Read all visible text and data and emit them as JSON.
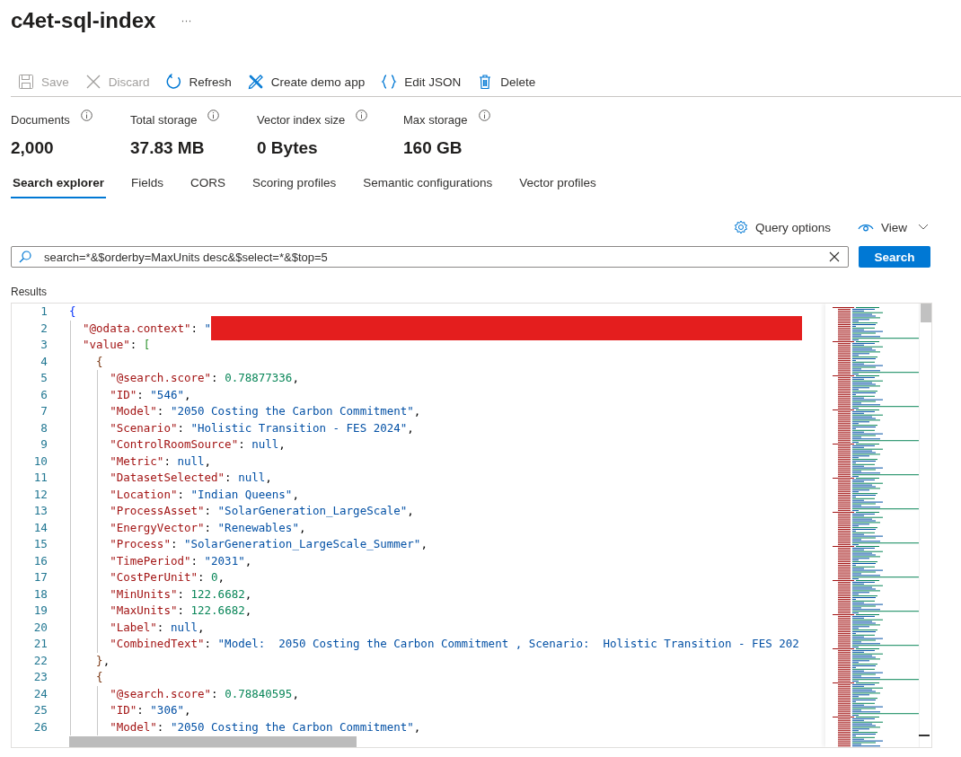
{
  "title": "c4et-sql-index",
  "more": "···",
  "toolbar": [
    {
      "label": "Save",
      "disabled": true
    },
    {
      "label": "Discard",
      "disabled": true
    },
    {
      "label": "Refresh",
      "disabled": false
    },
    {
      "label": "Create demo app",
      "disabled": false
    },
    {
      "label": "Edit JSON",
      "disabled": false
    },
    {
      "label": "Delete",
      "disabled": false
    }
  ],
  "stats": [
    {
      "label": "Documents",
      "value": "2,000"
    },
    {
      "label": "Total storage",
      "value": "37.83 MB"
    },
    {
      "label": "Vector index size",
      "value": "0 Bytes"
    },
    {
      "label": "Max storage",
      "value": "160 GB"
    }
  ],
  "tabs": [
    {
      "label": "Search explorer",
      "selected": true
    },
    {
      "label": "Fields",
      "selected": false
    },
    {
      "label": "CORS",
      "selected": false
    },
    {
      "label": "Scoring profiles",
      "selected": false
    },
    {
      "label": "Semantic configurations",
      "selected": false
    },
    {
      "label": "Vector profiles",
      "selected": false
    }
  ],
  "query_options": "Query options",
  "view": "View",
  "search": {
    "value": "search=*&$orderby=MaxUnits desc&$select=*&$top=5",
    "button": "Search"
  },
  "results": {
    "label": "Results",
    "lines": [
      {
        "number": "1",
        "tokens": [
          {
            "kind": "br1",
            "text": "{"
          }
        ]
      },
      {
        "number": "2",
        "tokens": [
          {
            "kind": "key",
            "text": "\"@odata.context\""
          },
          {
            "kind": "punct",
            "text": ": "
          },
          {
            "kind": "str",
            "text": "\""
          },
          {
            "kind": "redacted"
          }
        ]
      },
      {
        "number": "3",
        "tokens": [
          {
            "kind": "key",
            "text": "\"value\""
          },
          {
            "kind": "punct",
            "text": ": "
          },
          {
            "kind": "br2",
            "text": "["
          }
        ]
      },
      {
        "number": "4",
        "tokens": [
          {
            "kind": "br3",
            "text": "{"
          }
        ]
      },
      {
        "number": "5",
        "tokens": [
          {
            "kind": "key",
            "text": "\"@search.score\""
          },
          {
            "kind": "punct",
            "text": ": "
          },
          {
            "kind": "num",
            "text": "0.78877336"
          },
          {
            "kind": "punct",
            "text": ","
          }
        ]
      },
      {
        "number": "6",
        "tokens": [
          {
            "kind": "key",
            "text": "\"ID\""
          },
          {
            "kind": "punct",
            "text": ": "
          },
          {
            "kind": "str",
            "text": "\"546\""
          },
          {
            "kind": "punct",
            "text": ","
          }
        ]
      },
      {
        "number": "7",
        "tokens": [
          {
            "kind": "key",
            "text": "\"Model\""
          },
          {
            "kind": "punct",
            "text": ": "
          },
          {
            "kind": "str",
            "text": "\"2050 Costing the Carbon Commitment\""
          },
          {
            "kind": "punct",
            "text": ","
          }
        ]
      },
      {
        "number": "8",
        "tokens": [
          {
            "kind": "key",
            "text": "\"Scenario\""
          },
          {
            "kind": "punct",
            "text": ": "
          },
          {
            "kind": "str",
            "text": "\"Holistic Transition - FES 2024\""
          },
          {
            "kind": "punct",
            "text": ","
          }
        ]
      },
      {
        "number": "9",
        "tokens": [
          {
            "kind": "key",
            "text": "\"ControlRoomSource\""
          },
          {
            "kind": "punct",
            "text": ": "
          },
          {
            "kind": "null",
            "text": "null"
          },
          {
            "kind": "punct",
            "text": ","
          }
        ]
      },
      {
        "number": "10",
        "tokens": [
          {
            "kind": "key",
            "text": "\"Metric\""
          },
          {
            "kind": "punct",
            "text": ": "
          },
          {
            "kind": "null",
            "text": "null"
          },
          {
            "kind": "punct",
            "text": ","
          }
        ]
      },
      {
        "number": "11",
        "tokens": [
          {
            "kind": "key",
            "text": "\"DatasetSelected\""
          },
          {
            "kind": "punct",
            "text": ": "
          },
          {
            "kind": "null",
            "text": "null"
          },
          {
            "kind": "punct",
            "text": ","
          }
        ]
      },
      {
        "number": "12",
        "tokens": [
          {
            "kind": "key",
            "text": "\"Location\""
          },
          {
            "kind": "punct",
            "text": ": "
          },
          {
            "kind": "str",
            "text": "\"Indian Queens\""
          },
          {
            "kind": "punct",
            "text": ","
          }
        ]
      },
      {
        "number": "13",
        "tokens": [
          {
            "kind": "key",
            "text": "\"ProcessAsset\""
          },
          {
            "kind": "punct",
            "text": ": "
          },
          {
            "kind": "str",
            "text": "\"SolarGeneration_LargeScale\""
          },
          {
            "kind": "punct",
            "text": ","
          }
        ]
      },
      {
        "number": "14",
        "tokens": [
          {
            "kind": "key",
            "text": "\"EnergyVector\""
          },
          {
            "kind": "punct",
            "text": ": "
          },
          {
            "kind": "str",
            "text": "\"Renewables\""
          },
          {
            "kind": "punct",
            "text": ","
          }
        ]
      },
      {
        "number": "15",
        "tokens": [
          {
            "kind": "key",
            "text": "\"Process\""
          },
          {
            "kind": "punct",
            "text": ": "
          },
          {
            "kind": "str",
            "text": "\"SolarGeneration_LargeScale_Summer\""
          },
          {
            "kind": "punct",
            "text": ","
          }
        ]
      },
      {
        "number": "16",
        "tokens": [
          {
            "kind": "key",
            "text": "\"TimePeriod\""
          },
          {
            "kind": "punct",
            "text": ": "
          },
          {
            "kind": "str",
            "text": "\"2031\""
          },
          {
            "kind": "punct",
            "text": ","
          }
        ]
      },
      {
        "number": "17",
        "tokens": [
          {
            "kind": "key",
            "text": "\"CostPerUnit\""
          },
          {
            "kind": "punct",
            "text": ": "
          },
          {
            "kind": "num",
            "text": "0"
          },
          {
            "kind": "punct",
            "text": ","
          }
        ]
      },
      {
        "number": "18",
        "tokens": [
          {
            "kind": "key",
            "text": "\"MinUnits\""
          },
          {
            "kind": "punct",
            "text": ": "
          },
          {
            "kind": "num",
            "text": "122.6682"
          },
          {
            "kind": "punct",
            "text": ","
          }
        ]
      },
      {
        "number": "19",
        "tokens": [
          {
            "kind": "key",
            "text": "\"MaxUnits\""
          },
          {
            "kind": "punct",
            "text": ": "
          },
          {
            "kind": "num",
            "text": "122.6682"
          },
          {
            "kind": "punct",
            "text": ","
          }
        ]
      },
      {
        "number": "20",
        "tokens": [
          {
            "kind": "key",
            "text": "\"Label\""
          },
          {
            "kind": "punct",
            "text": ": "
          },
          {
            "kind": "null",
            "text": "null"
          },
          {
            "kind": "punct",
            "text": ","
          }
        ]
      },
      {
        "number": "21",
        "tokens": [
          {
            "kind": "key",
            "text": "\"CombinedText\""
          },
          {
            "kind": "punct",
            "text": ": "
          },
          {
            "kind": "str",
            "text": "\"Model:  2050 Costing the Carbon Commitment , Scenario:  Holistic Transition - FES 202"
          }
        ]
      },
      {
        "number": "22",
        "tokens": [
          {
            "kind": "br3",
            "text": "}"
          },
          {
            "kind": "punct",
            "text": ","
          }
        ]
      },
      {
        "number": "23",
        "tokens": [
          {
            "kind": "br3",
            "text": "{"
          }
        ]
      },
      {
        "number": "24",
        "tokens": [
          {
            "kind": "key",
            "text": "\"@search.score\""
          },
          {
            "kind": "punct",
            "text": ": "
          },
          {
            "kind": "num",
            "text": "0.78840595"
          },
          {
            "kind": "punct",
            "text": ","
          }
        ]
      },
      {
        "number": "25",
        "tokens": [
          {
            "kind": "key",
            "text": "\"ID\""
          },
          {
            "kind": "punct",
            "text": ": "
          },
          {
            "kind": "str",
            "text": "\"306\""
          },
          {
            "kind": "punct",
            "text": ","
          }
        ]
      },
      {
        "number": "26",
        "tokens": [
          {
            "kind": "key",
            "text": "\"Model\""
          },
          {
            "kind": "punct",
            "text": ": "
          },
          {
            "kind": "str",
            "text": "\"2050 Costing the Carbon Commitment\""
          },
          {
            "kind": "punct",
            "text": ","
          }
        ]
      }
    ]
  }
}
